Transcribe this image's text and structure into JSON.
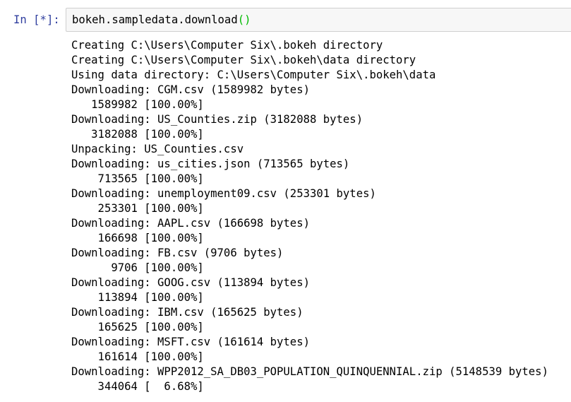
{
  "cell": {
    "prompt": "In [*]:",
    "code_text": "bokeh.sampledata.download",
    "code_parens": "()"
  },
  "output_lines": [
    "Creating C:\\Users\\Computer Six\\.bokeh directory",
    "Creating C:\\Users\\Computer Six\\.bokeh\\data directory",
    "Using data directory: C:\\Users\\Computer Six\\.bokeh\\data",
    "Downloading: CGM.csv (1589982 bytes)",
    "   1589982 [100.00%]",
    "Downloading: US_Counties.zip (3182088 bytes)",
    "   3182088 [100.00%]",
    "Unpacking: US_Counties.csv",
    "Downloading: us_cities.json (713565 bytes)",
    "    713565 [100.00%]",
    "Downloading: unemployment09.csv (253301 bytes)",
    "    253301 [100.00%]",
    "Downloading: AAPL.csv (166698 bytes)",
    "    166698 [100.00%]",
    "Downloading: FB.csv (9706 bytes)",
    "      9706 [100.00%]",
    "Downloading: GOOG.csv (113894 bytes)",
    "    113894 [100.00%]",
    "Downloading: IBM.csv (165625 bytes)",
    "    165625 [100.00%]",
    "Downloading: MSFT.csv (161614 bytes)",
    "    161614 [100.00%]",
    "Downloading: WPP2012_SA_DB03_POPULATION_QUINQUENNIAL.zip (5148539 bytes)",
    "    344064 [  6.68%]"
  ],
  "colors": {
    "prompt": "#303f9f",
    "paren": "#00bb00",
    "input_background": "#f7f7f7",
    "input_border": "#cfcfcf"
  }
}
